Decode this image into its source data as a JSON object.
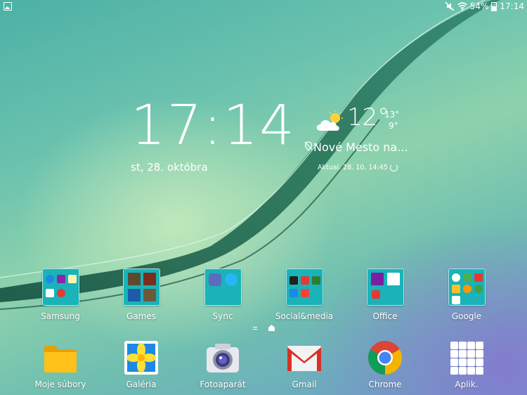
{
  "status_bar": {
    "battery": "54%",
    "time": "17:14",
    "icons": [
      "gallery-notification-icon",
      "mute-icon",
      "wifi-icon",
      "battery-icon"
    ]
  },
  "clock_widget": {
    "time": "17:14",
    "date": "st, 28. októbra"
  },
  "weather_widget": {
    "temperature": "12°",
    "high": "13°",
    "low": "9°",
    "location": "Nové Mesto na...",
    "updated": "Aktual. 28. 10. 14:45",
    "icon": "partly-cloudy-icon"
  },
  "folders": [
    {
      "label": "Samsung"
    },
    {
      "label": "Games"
    },
    {
      "label": "Sync"
    },
    {
      "label": "Social&media"
    },
    {
      "label": "Office"
    },
    {
      "label": "Google"
    }
  ],
  "dock": [
    {
      "label": "Moje súbory",
      "icon": "my-files-icon"
    },
    {
      "label": "Galéria",
      "icon": "gallery-icon"
    },
    {
      "label": "Fotoaparát",
      "icon": "camera-icon"
    },
    {
      "label": "Gmail",
      "icon": "gmail-icon"
    },
    {
      "label": "Chrome",
      "icon": "chrome-icon"
    },
    {
      "label": "Aplik.",
      "icon": "apps-grid-icon"
    }
  ],
  "colors": {
    "folder_bg": "#19b3b8",
    "wallpaper_green": "#6cc3ae",
    "wallpaper_purple": "#8c6ed2"
  }
}
